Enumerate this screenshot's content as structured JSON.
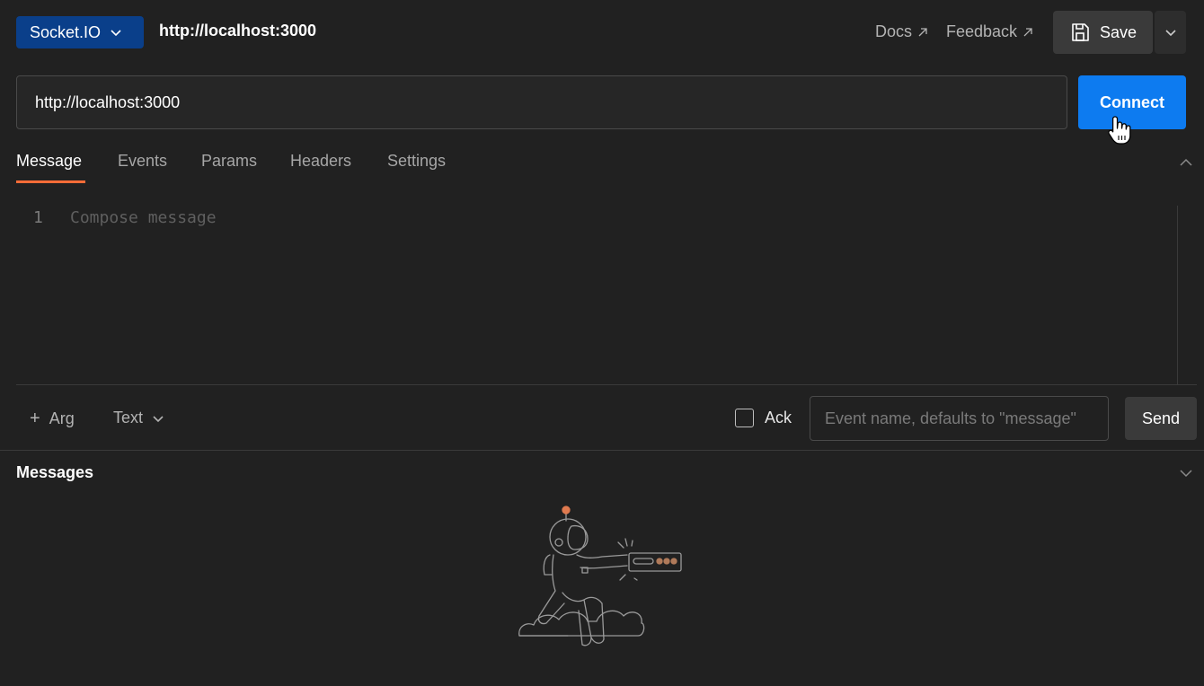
{
  "header": {
    "protocol_label": "Socket.IO",
    "request_title": "http://localhost:3000",
    "docs_label": "Docs",
    "feedback_label": "Feedback",
    "save_label": "Save"
  },
  "url_bar": {
    "value": "http://localhost:3000",
    "connect_label": "Connect"
  },
  "tabs": [
    {
      "label": "Message",
      "active": true
    },
    {
      "label": "Events"
    },
    {
      "label": "Params"
    },
    {
      "label": "Headers"
    },
    {
      "label": "Settings"
    }
  ],
  "editor": {
    "line_number": "1",
    "placeholder": "Compose message"
  },
  "compose_bar": {
    "add_arg_label": "Arg",
    "type_label": "Text",
    "ack_label": "Ack",
    "event_placeholder": "Event name, defaults to \"message\"",
    "send_label": "Send"
  },
  "messages": {
    "title": "Messages"
  },
  "colors": {
    "accent_tab": "#ff6c37",
    "connect_blue": "#0d7bf0",
    "protocol_blue": "#0a3f8a",
    "background": "#212121"
  },
  "icons": [
    "chevron-down-icon",
    "external-link-icon",
    "save-icon",
    "hand-cursor-icon",
    "chevron-up-icon",
    "plus-icon",
    "astronaut-illustration"
  ]
}
